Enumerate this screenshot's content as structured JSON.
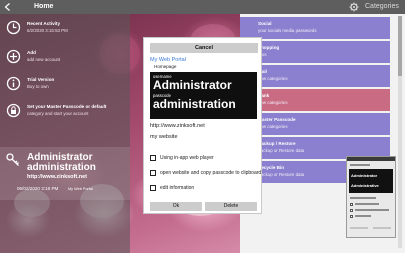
{
  "titlebar": {
    "title": "Home",
    "categories_label": "Categories"
  },
  "menu": [
    {
      "title": "Recent Activity",
      "subtitle": "6/2/2020 3:15:53 PM",
      "icon": "clock-icon"
    },
    {
      "title": "Add",
      "subtitle": "add new account",
      "icon": "add-icon"
    },
    {
      "title": "Trial Version",
      "subtitle": "Buy to own",
      "icon": "info-icon"
    },
    {
      "title": "Set your Master Passcode or default",
      "subtitle": "category and start your account",
      "icon": "lock-icon"
    }
  ],
  "credential_card": {
    "line1": "Administrator",
    "line2": "administration",
    "url": "http://www.zinksoft.net",
    "date": "06/02/2020 3:16 PM",
    "portal": "My Web Portal"
  },
  "categories": [
    {
      "title": "Social",
      "subtitle": "your socials media passwords",
      "color": "#8b80cf"
    },
    {
      "title": "Shopping",
      "subtitle": "iPos",
      "color": "#8b80cf"
    },
    {
      "title": "Mail",
      "subtitle": "new categories",
      "color": "#8b80cf"
    },
    {
      "title": "Bank",
      "subtitle": "new categories",
      "color": "#c96b83"
    },
    {
      "title": "Master Passcode",
      "subtitle": "new categories",
      "color": "#8b80cf"
    },
    {
      "title": "Backup / Restore",
      "subtitle": "Backup or Restore data",
      "color": "#8b80cf"
    },
    {
      "title": "Recycle Bin",
      "subtitle": "Backup or Restore data",
      "color": "#8b80cf"
    }
  ],
  "mini_preview": {
    "line1": "Administrator",
    "line2": "Administrative"
  },
  "dialog": {
    "cancel_label": "Cancel",
    "title": "My Web Portal",
    "subtitle": "Homepage",
    "username_label": "username",
    "username": "Administrator",
    "password_label": "passcode",
    "password": "administration",
    "url": "http://www.zinksoft.net",
    "description": "my website",
    "options": [
      {
        "label": "Using in-app web player",
        "checked": false
      },
      {
        "label": "open website and copy passcode to clipboard",
        "checked": false
      },
      {
        "label": "edit information",
        "checked": false
      }
    ],
    "ok_label": "Ok",
    "delete_label": "Delete"
  }
}
